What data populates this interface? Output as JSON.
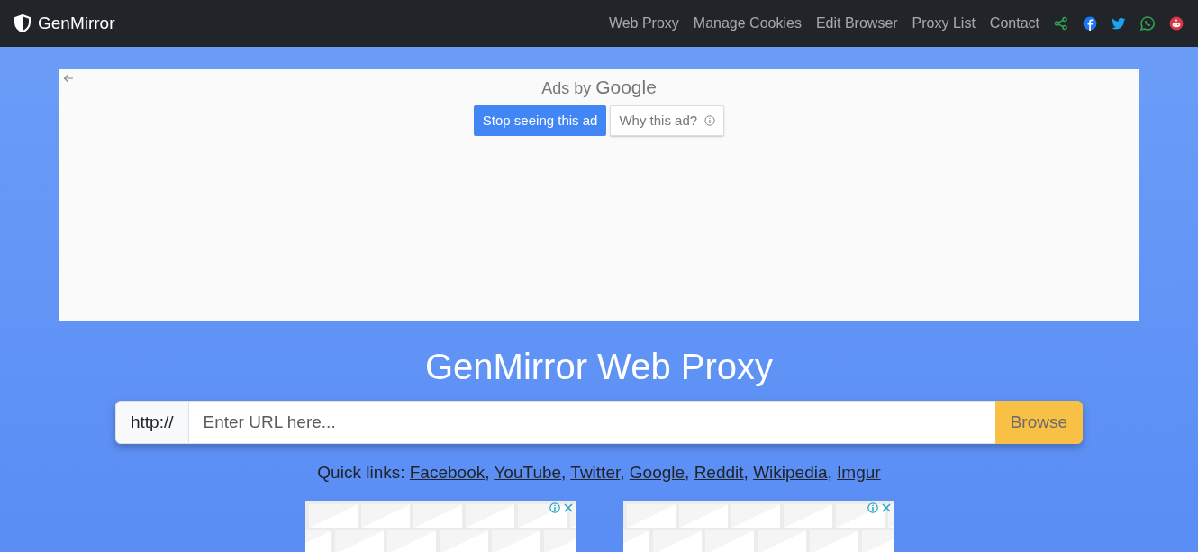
{
  "navbar": {
    "brand": "GenMirror",
    "links": [
      "Web Proxy",
      "Manage Cookies",
      "Edit Browser",
      "Proxy List",
      "Contact"
    ]
  },
  "ad_banner": {
    "label": "Ads by",
    "logo_text": "Google",
    "buttons": [
      {
        "kind": "primary",
        "label": "Stop seeing this ad"
      },
      {
        "kind": "info",
        "label": "Why this ad?"
      }
    ]
  },
  "hero": {
    "title": "GenMirror Web Proxy",
    "prefix": "http://",
    "placeholder": "Enter URL here...",
    "button": "Browse"
  },
  "quick_links": {
    "label": "Quick links:",
    "separator": ",",
    "links": [
      "Facebook",
      "YouTube",
      "Twitter",
      "Google",
      "Reddit",
      "Wikipedia",
      "Imgur"
    ]
  }
}
